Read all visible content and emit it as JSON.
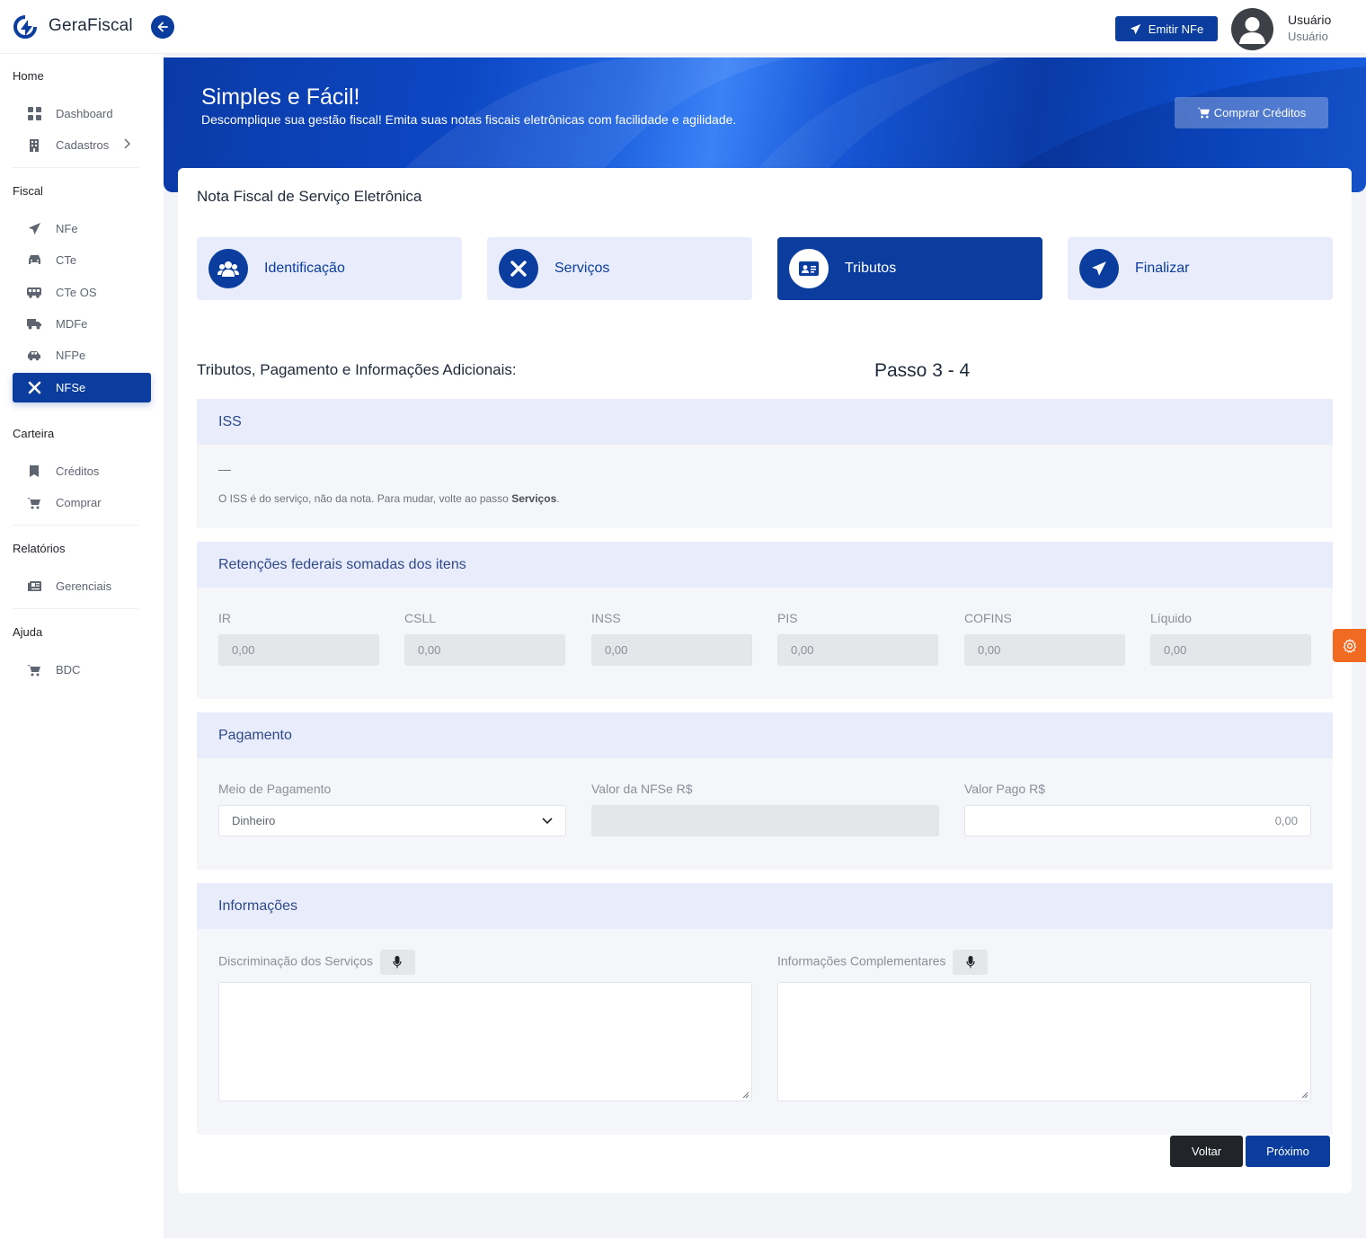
{
  "app": {
    "brand": "GeraFiscal"
  },
  "header": {
    "emit_button": "Emitir NFe",
    "user_name": "Usuário",
    "user_role": "Usuário"
  },
  "sidebar": {
    "sections": {
      "home": "Home",
      "fiscal": "Fiscal",
      "carteira": "Carteira",
      "relatorios": "Relatórios",
      "ajuda": "Ajuda"
    },
    "items": {
      "dashboard": "Dashboard",
      "cadastros": "Cadastros",
      "nfe": "NFe",
      "cte": "CTe",
      "cteos": "CTe OS",
      "mdfe": "MDFe",
      "nfpe": "NFPe",
      "nfse": "NFSe",
      "creditos": "Créditos",
      "comprar": "Comprar",
      "gerenciais": "Gerenciais",
      "bdc": "BDC"
    },
    "active_item": "NFSe"
  },
  "banner": {
    "title": "Simples e Fácil!",
    "subtitle": "Descomplique sua gestão fiscal! Emita suas notas fiscais eletrônicas com facilidade e agilidade.",
    "buy_button": "Comprar Créditos"
  },
  "page": {
    "title": "Nota Fiscal de Serviço Eletrônica",
    "steps": [
      "Identificação",
      "Serviços",
      "Tributos",
      "Finalizar"
    ],
    "active_step": "Tributos",
    "subtitle": "Tributos, Pagamento e Informações Adicionais:",
    "step_indicator": "Passo 3 - 4"
  },
  "iss": {
    "heading": "ISS",
    "note_prefix": "O ISS é do serviço, não da nota. Para mudar, volte ao passo ",
    "note_bold": "Serviços",
    "note_suffix": "."
  },
  "retencoes": {
    "heading": "Retenções federais somadas dos itens",
    "fields": {
      "ir": {
        "label": "IR",
        "value": "0,00"
      },
      "csll": {
        "label": "CSLL",
        "value": "0,00"
      },
      "inss": {
        "label": "INSS",
        "value": "0,00"
      },
      "pis": {
        "label": "PIS",
        "value": "0,00"
      },
      "cofins": {
        "label": "COFINS",
        "value": "0,00"
      },
      "liquido": {
        "label": "Líquido",
        "value": "0,00"
      }
    }
  },
  "pagamento": {
    "heading": "Pagamento",
    "meio_label": "Meio de Pagamento",
    "meio_value": "Dinheiro",
    "valor_nfse_label": "Valor da NFSe R$",
    "valor_nfse_value": "",
    "valor_pago_label": "Valor Pago R$",
    "valor_pago_value": "0,00"
  },
  "informacoes": {
    "heading": "Informações",
    "discriminacao_label": "Discriminação dos Serviços",
    "complementares_label": "Informações Complementares"
  },
  "actions": {
    "back": "Voltar",
    "next": "Próximo"
  },
  "colors": {
    "primary": "#0b3d9e",
    "accent": "#f06a21",
    "dark": "#212529"
  }
}
